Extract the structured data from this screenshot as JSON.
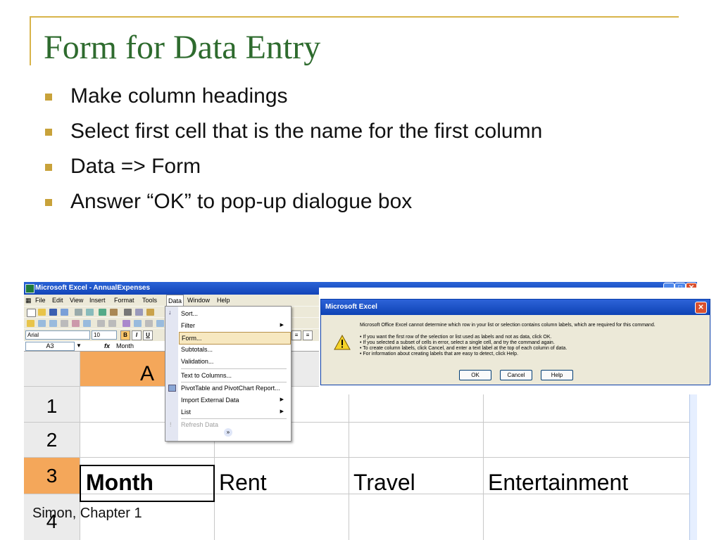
{
  "slide": {
    "title": "Form for Data Entry",
    "bullets": [
      "Make column headings",
      "Select first cell that is the name for the first column",
      "Data => Form",
      "Answer “OK” to pop-up dialogue box"
    ],
    "footer": "Simon, Chapter 1"
  },
  "excel": {
    "window_title": "Microsoft Excel - AnnualExpenses",
    "menu": [
      "File",
      "Edit",
      "View",
      "Insert",
      "Format",
      "Tools",
      "Data",
      "Window",
      "Help"
    ],
    "active_menu": "Data",
    "font_name": "Arial",
    "font_size": "10",
    "name_box": "A3",
    "formula_fx": "fx",
    "formula_value": "Month",
    "column_header": "A",
    "row_headers": [
      "1",
      "2",
      "3",
      "4"
    ],
    "row3_cells": [
      "Month",
      "Rent",
      "Travel",
      "Entertainment"
    ],
    "data_menu": {
      "items": [
        "Sort...",
        "Filter",
        "Form...",
        "Subtotals...",
        "Validation...",
        "Text to Columns...",
        "PivotTable and PivotChart Report...",
        "Import External Data",
        "List",
        "Refresh Data"
      ],
      "highlighted": "Form..."
    }
  },
  "dialog": {
    "title": "Microsoft Excel",
    "message": "Microsoft Office Excel cannot determine which row in your list or selection contains column labels, which are required for this command.",
    "bullets": [
      "• If you want the first row of the selection or list used as labels and not as data, click OK.",
      "• If you selected a subset of cells in error, select a single cell, and try the command again.",
      "• To create column labels, click Cancel, and enter a text label at the top of each column of data.",
      "• For information about creating labels that are easy to detect, click Help."
    ],
    "buttons": {
      "ok": "OK",
      "cancel": "Cancel",
      "help": "Help"
    }
  },
  "colors": {
    "title_green": "#2e6b2e",
    "bullet_gold": "#c8a23a",
    "header_selected": "#f4a75a",
    "xp_blue": "#1244b8"
  }
}
